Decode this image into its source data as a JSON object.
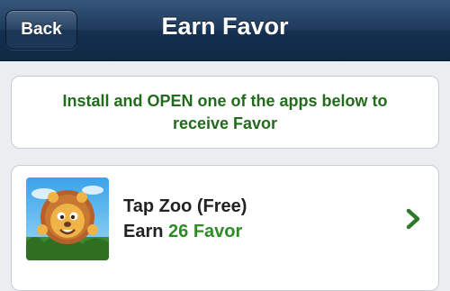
{
  "navbar": {
    "back_label": "Back",
    "title": "Earn Favor"
  },
  "instruction": {
    "text": "Install and OPEN one of the apps below to receive Favor"
  },
  "apps": [
    {
      "name": "Tap Zoo (Free)",
      "earn_label": "Earn",
      "earn_amount": "26 Favor",
      "icon": "tap-zoo-lion-icon"
    }
  ],
  "colors": {
    "navbar": "#1f3b5d",
    "instruction_text": "#226b1c",
    "earn_amount": "#2e8b27",
    "chevron": "#2f7a2a"
  }
}
